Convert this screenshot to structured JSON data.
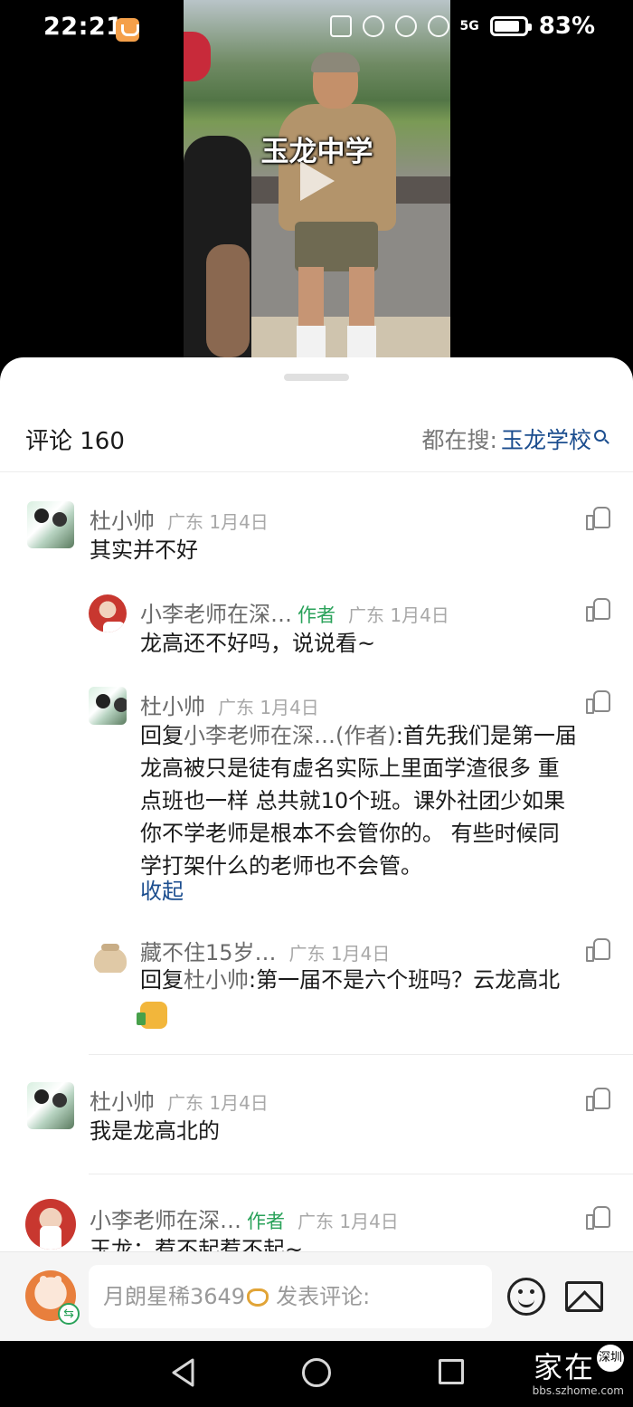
{
  "status_bar": {
    "time": "22:21",
    "network": "5G",
    "battery": "83%"
  },
  "video": {
    "caption": "玉龙中学"
  },
  "comments_panel": {
    "title": "评论 160",
    "search_prefix": "都在搜:",
    "search_term": "玉龙学校"
  },
  "comments": [
    {
      "name": "杜小帅",
      "meta": "广东 1月4日",
      "text": "其实并不好"
    },
    {
      "name": "小李老师在深…",
      "author_badge": "作者",
      "meta": "广东 1月4日",
      "text": "龙高还不好吗，说说看~"
    },
    {
      "name": "杜小帅",
      "meta": "广东 1月4日",
      "reply_prefix": "回复",
      "reply_target": "小李老师在深…(作者)",
      "text_lines": [
        ":首先我们是第一届",
        "龙高被只是徒有虚名实际上里面学渣很多 重",
        "点班也一样 总共就10个班。课外社团少如果",
        "你不学老师是根本不会管你的。 有些时候同",
        "学打架什么的老师也不会管。"
      ],
      "collapse": "收起"
    },
    {
      "name": "藏不住15岁…",
      "meta": "广东 1月4日",
      "reply_prefix": "回复",
      "reply_target": "杜小帅",
      "text": ":第一届不是六个班吗？云龙高北"
    },
    {
      "name": "杜小帅",
      "meta": "广东 1月4日",
      "text": "我是龙高北的"
    },
    {
      "name": "小李老师在深…",
      "author_badge": "作者",
      "meta": "广东 1月4日",
      "text": "玉龙：惹不起惹不起~"
    }
  ],
  "input_bar": {
    "username": "月朗星稀3649",
    "placeholder": "发表评论:"
  },
  "watermark": {
    "text": "家在",
    "seal": "深圳",
    "url": "bbs.szhome.com"
  },
  "icons": [
    "like-icon",
    "search-icon",
    "emoji-icon",
    "image-icon",
    "back-icon",
    "home-icon",
    "recent-apps-icon",
    "play-icon"
  ],
  "colors": {
    "link": "#1c4e8f",
    "author_badge": "#2aa25a",
    "meta": "#a8a8a8"
  }
}
